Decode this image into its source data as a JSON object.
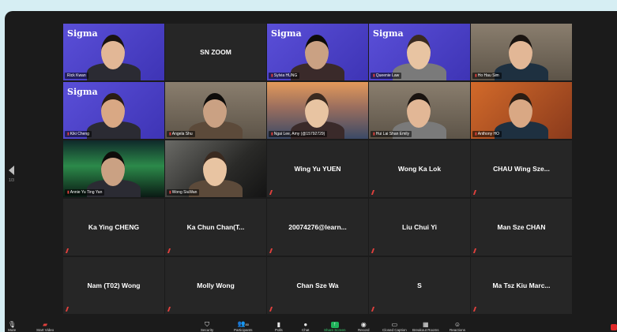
{
  "colors": {
    "page_bg": "#d6eef3",
    "window_bg": "#1b1b1b",
    "tile_bg": "#262626",
    "sigma_purple": "#4a3fc4",
    "active_speaker": "#c9e06a",
    "muted_red": "#e0403d",
    "share_green": "#1fb25a"
  },
  "brand_text": "Sigma",
  "page_indicator": "1/3",
  "participants": [
    {
      "name": "Rick Kwan",
      "kind": "video",
      "bg": "sigma",
      "active": true
    },
    {
      "name": "SN ZOOM",
      "kind": "name_only",
      "muted": false
    },
    {
      "name": "Sylvia HUNG",
      "kind": "video",
      "bg": "sigma"
    },
    {
      "name": "Queenie Law",
      "kind": "video",
      "bg": "sigma"
    },
    {
      "name": "Ho Hau Sim",
      "kind": "video",
      "bg": "room"
    },
    {
      "name": "Kiki Cheng",
      "kind": "video",
      "bg": "sigma"
    },
    {
      "name": "Angela Shu",
      "kind": "video",
      "bg": "room"
    },
    {
      "name": "Ngai Lee, Amy (@15792729)",
      "kind": "video",
      "bg": "bridge"
    },
    {
      "name": "Hui Lai Shan Emily",
      "kind": "video",
      "bg": "room"
    },
    {
      "name": "Anthony HO",
      "kind": "video",
      "bg": "orange"
    },
    {
      "name": "Annie Yu Ting Yan",
      "kind": "video",
      "bg": "aurora"
    },
    {
      "name": "Wong SiuWan",
      "kind": "video",
      "bg": "dark"
    },
    {
      "name": "Wing Yu YUEN",
      "kind": "name_only",
      "muted": true
    },
    {
      "name": "Wong Ka Lok",
      "kind": "name_only",
      "muted": true
    },
    {
      "name": "CHAU Wing Sze...",
      "kind": "name_only",
      "muted": true
    },
    {
      "name": "Ka Ying CHENG",
      "kind": "name_only",
      "muted": true
    },
    {
      "name": "Ka Chun Chan(T...",
      "kind": "name_only",
      "muted": true
    },
    {
      "name": "20074276@learn...",
      "kind": "name_only",
      "muted": true
    },
    {
      "name": "Liu Chui Yi",
      "kind": "name_only",
      "muted": true
    },
    {
      "name": "Man Sze CHAN",
      "kind": "name_only",
      "muted": true
    },
    {
      "name": "Nam (T02) Wong",
      "kind": "name_only",
      "muted": true
    },
    {
      "name": "Molly Wong",
      "kind": "name_only",
      "muted": true
    },
    {
      "name": "Chan Sze Wa",
      "kind": "name_only",
      "muted": true
    },
    {
      "name": "S",
      "kind": "name_only",
      "muted": true
    },
    {
      "name": "Ma Tsz Kiu Marc...",
      "kind": "name_only",
      "muted": true
    }
  ],
  "toolbar": {
    "mute": "Mute",
    "start_video": "Start Video",
    "security": "Security",
    "participants": "Participants",
    "participants_count": "80",
    "polls": "Polls",
    "chat": "Chat",
    "share_screen": "Share Screen",
    "record": "Record",
    "closed_caption": "Closed Caption",
    "breakout_rooms": "Breakout Rooms",
    "reactions": "Reactions"
  }
}
